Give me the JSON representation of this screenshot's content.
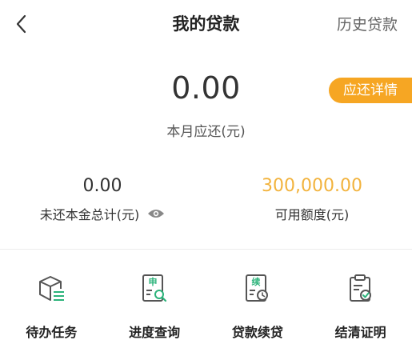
{
  "header": {
    "back_icon": "chevron-left-icon",
    "title": "我的贷款",
    "history_link": "历史贷款"
  },
  "summary": {
    "amount": "0.00",
    "amount_label": "本月应还(元)",
    "detail_button": "应还详情"
  },
  "stats": {
    "principal_value": "0.00",
    "principal_label": "未还本金总计(元)",
    "credit_value": "300,000.00",
    "credit_label": "可用额度(元)"
  },
  "tasks": [
    {
      "label": "待办任务",
      "icon": "box-list-icon"
    },
    {
      "label": "进度查询",
      "icon": "application-search-icon",
      "glyph": "申"
    },
    {
      "label": "贷款续贷",
      "icon": "renewal-clock-icon",
      "glyph": "续"
    },
    {
      "label": "结清证明",
      "icon": "clipboard-check-icon"
    }
  ],
  "colors": {
    "accent_orange": "#f6a623",
    "credit_gold": "#f2b33d",
    "icon_gray": "#555555",
    "icon_green": "#2bb37a"
  }
}
